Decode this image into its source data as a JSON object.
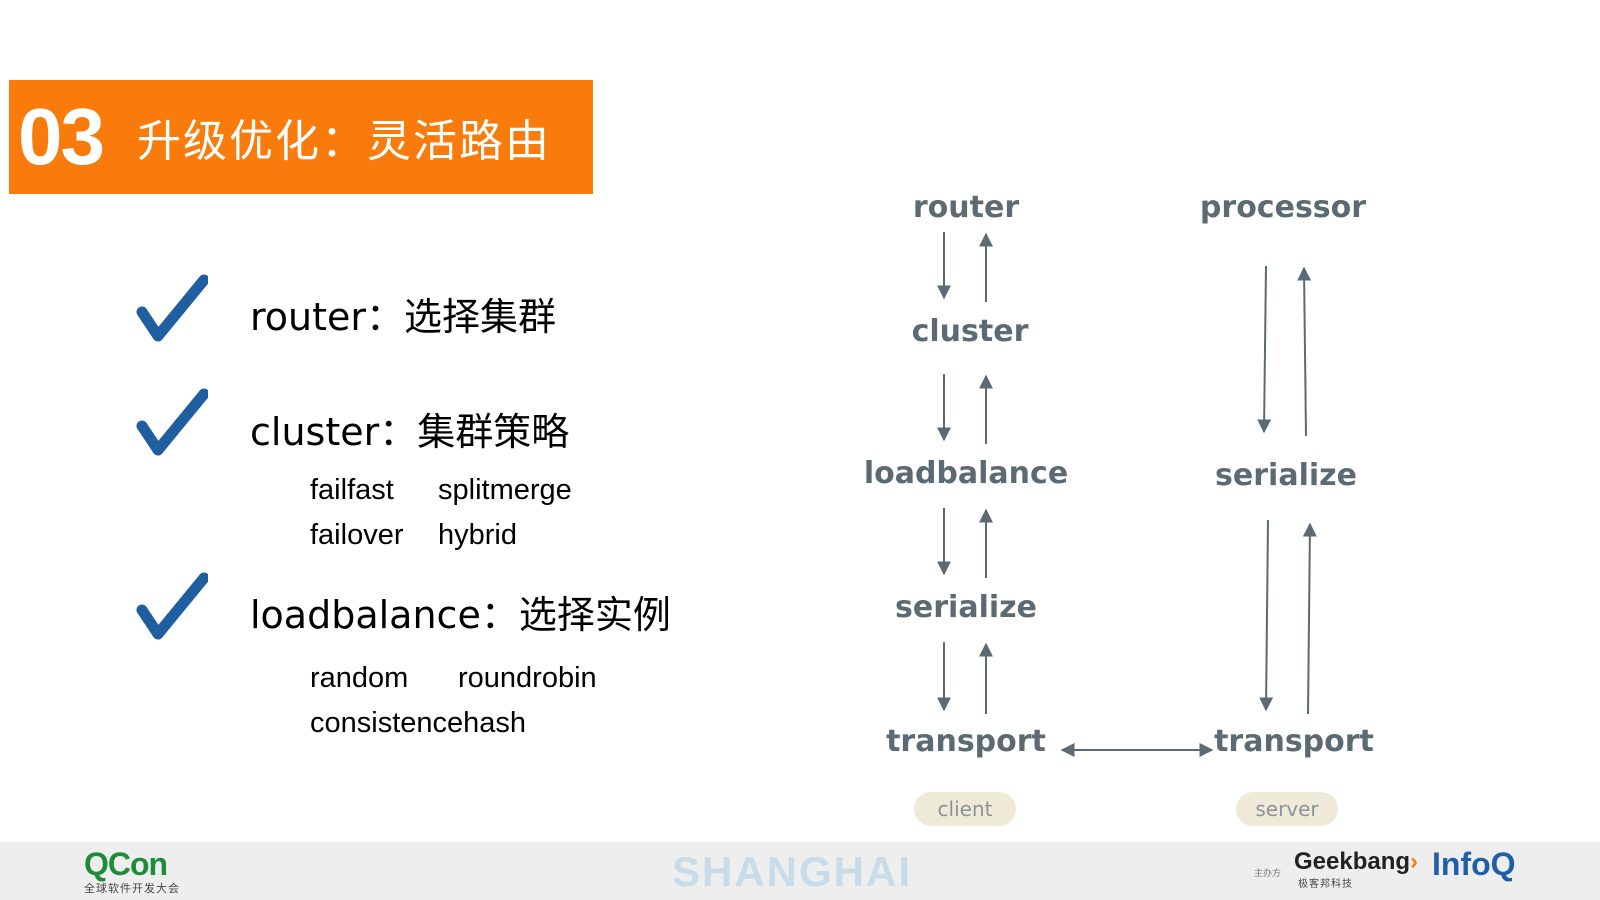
{
  "slide": {
    "number": "03",
    "title": "升级优化：灵活路由"
  },
  "features": [
    {
      "label": "router：选择集群",
      "icon": "check-icon"
    },
    {
      "label": "cluster：集群策略",
      "icon": "check-icon"
    },
    {
      "label": "loadbalance：选择实例",
      "icon": "check-icon"
    }
  ],
  "cluster_options": [
    "failfast",
    "splitmerge",
    "failover",
    "hybrid"
  ],
  "loadbalance_options": [
    "random",
    "roundrobin",
    "consistencehash"
  ],
  "diagram": {
    "client_nodes": [
      "router",
      "cluster",
      "loadbalance",
      "serialize",
      "transport"
    ],
    "server_nodes": [
      "processor",
      "serialize",
      "transport"
    ],
    "client_label": "client",
    "server_label": "server",
    "colors": {
      "node": "#5c6b73",
      "arrow": "#5c6b73",
      "pill": "#efe9d8"
    }
  },
  "footer": {
    "qcon": "QCon",
    "qcon_sub": "全球软件开发大会",
    "city": "SHANGHAI",
    "sponsor_label": "主办方",
    "geekbang": "Geekbang",
    "geekbang_sub": "极客邦科技",
    "infoq": "InfoQ"
  },
  "colors": {
    "accent": "#f97b0b",
    "check": "#1f5fa0"
  }
}
